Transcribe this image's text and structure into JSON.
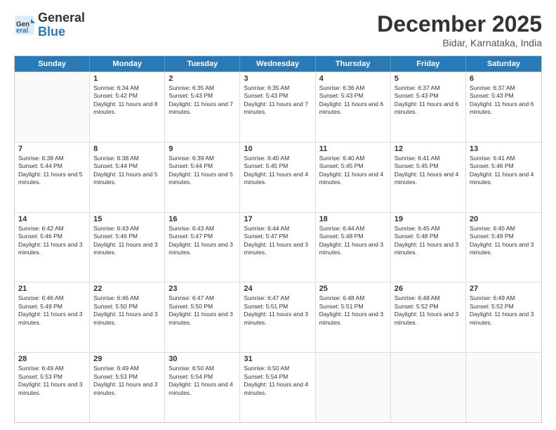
{
  "header": {
    "logo": {
      "general": "General",
      "blue": "Blue"
    },
    "title": "December 2025",
    "location": "Bidar, Karnataka, India"
  },
  "days_of_week": [
    "Sunday",
    "Monday",
    "Tuesday",
    "Wednesday",
    "Thursday",
    "Friday",
    "Saturday"
  ],
  "weeks": [
    [
      {
        "day": "",
        "sunrise": "",
        "sunset": "",
        "daylight": ""
      },
      {
        "day": "1",
        "sunrise": "Sunrise: 6:34 AM",
        "sunset": "Sunset: 5:42 PM",
        "daylight": "Daylight: 11 hours and 8 minutes."
      },
      {
        "day": "2",
        "sunrise": "Sunrise: 6:35 AM",
        "sunset": "Sunset: 5:43 PM",
        "daylight": "Daylight: 11 hours and 7 minutes."
      },
      {
        "day": "3",
        "sunrise": "Sunrise: 6:35 AM",
        "sunset": "Sunset: 5:43 PM",
        "daylight": "Daylight: 11 hours and 7 minutes."
      },
      {
        "day": "4",
        "sunrise": "Sunrise: 6:36 AM",
        "sunset": "Sunset: 5:43 PM",
        "daylight": "Daylight: 11 hours and 6 minutes."
      },
      {
        "day": "5",
        "sunrise": "Sunrise: 6:37 AM",
        "sunset": "Sunset: 5:43 PM",
        "daylight": "Daylight: 11 hours and 6 minutes."
      },
      {
        "day": "6",
        "sunrise": "Sunrise: 6:37 AM",
        "sunset": "Sunset: 5:43 PM",
        "daylight": "Daylight: 11 hours and 6 minutes."
      }
    ],
    [
      {
        "day": "7",
        "sunrise": "Sunrise: 6:38 AM",
        "sunset": "Sunset: 5:44 PM",
        "daylight": "Daylight: 11 hours and 5 minutes."
      },
      {
        "day": "8",
        "sunrise": "Sunrise: 6:38 AM",
        "sunset": "Sunset: 5:44 PM",
        "daylight": "Daylight: 11 hours and 5 minutes."
      },
      {
        "day": "9",
        "sunrise": "Sunrise: 6:39 AM",
        "sunset": "Sunset: 5:44 PM",
        "daylight": "Daylight: 11 hours and 5 minutes."
      },
      {
        "day": "10",
        "sunrise": "Sunrise: 6:40 AM",
        "sunset": "Sunset: 5:45 PM",
        "daylight": "Daylight: 11 hours and 4 minutes."
      },
      {
        "day": "11",
        "sunrise": "Sunrise: 6:40 AM",
        "sunset": "Sunset: 5:45 PM",
        "daylight": "Daylight: 11 hours and 4 minutes."
      },
      {
        "day": "12",
        "sunrise": "Sunrise: 6:41 AM",
        "sunset": "Sunset: 5:45 PM",
        "daylight": "Daylight: 11 hours and 4 minutes."
      },
      {
        "day": "13",
        "sunrise": "Sunrise: 6:41 AM",
        "sunset": "Sunset: 5:46 PM",
        "daylight": "Daylight: 11 hours and 4 minutes."
      }
    ],
    [
      {
        "day": "14",
        "sunrise": "Sunrise: 6:42 AM",
        "sunset": "Sunset: 5:46 PM",
        "daylight": "Daylight: 11 hours and 3 minutes."
      },
      {
        "day": "15",
        "sunrise": "Sunrise: 6:43 AM",
        "sunset": "Sunset: 5:46 PM",
        "daylight": "Daylight: 11 hours and 3 minutes."
      },
      {
        "day": "16",
        "sunrise": "Sunrise: 6:43 AM",
        "sunset": "Sunset: 5:47 PM",
        "daylight": "Daylight: 11 hours and 3 minutes."
      },
      {
        "day": "17",
        "sunrise": "Sunrise: 6:44 AM",
        "sunset": "Sunset: 5:47 PM",
        "daylight": "Daylight: 11 hours and 3 minutes."
      },
      {
        "day": "18",
        "sunrise": "Sunrise: 6:44 AM",
        "sunset": "Sunset: 5:48 PM",
        "daylight": "Daylight: 11 hours and 3 minutes."
      },
      {
        "day": "19",
        "sunrise": "Sunrise: 6:45 AM",
        "sunset": "Sunset: 5:48 PM",
        "daylight": "Daylight: 11 hours and 3 minutes."
      },
      {
        "day": "20",
        "sunrise": "Sunrise: 6:45 AM",
        "sunset": "Sunset: 5:49 PM",
        "daylight": "Daylight: 11 hours and 3 minutes."
      }
    ],
    [
      {
        "day": "21",
        "sunrise": "Sunrise: 6:46 AM",
        "sunset": "Sunset: 5:49 PM",
        "daylight": "Daylight: 11 hours and 3 minutes."
      },
      {
        "day": "22",
        "sunrise": "Sunrise: 6:46 AM",
        "sunset": "Sunset: 5:50 PM",
        "daylight": "Daylight: 11 hours and 3 minutes."
      },
      {
        "day": "23",
        "sunrise": "Sunrise: 6:47 AM",
        "sunset": "Sunset: 5:50 PM",
        "daylight": "Daylight: 11 hours and 3 minutes."
      },
      {
        "day": "24",
        "sunrise": "Sunrise: 6:47 AM",
        "sunset": "Sunset: 5:51 PM",
        "daylight": "Daylight: 11 hours and 3 minutes."
      },
      {
        "day": "25",
        "sunrise": "Sunrise: 6:48 AM",
        "sunset": "Sunset: 5:51 PM",
        "daylight": "Daylight: 11 hours and 3 minutes."
      },
      {
        "day": "26",
        "sunrise": "Sunrise: 6:48 AM",
        "sunset": "Sunset: 5:52 PM",
        "daylight": "Daylight: 11 hours and 3 minutes."
      },
      {
        "day": "27",
        "sunrise": "Sunrise: 6:49 AM",
        "sunset": "Sunset: 5:52 PM",
        "daylight": "Daylight: 11 hours and 3 minutes."
      }
    ],
    [
      {
        "day": "28",
        "sunrise": "Sunrise: 6:49 AM",
        "sunset": "Sunset: 5:53 PM",
        "daylight": "Daylight: 11 hours and 3 minutes."
      },
      {
        "day": "29",
        "sunrise": "Sunrise: 6:49 AM",
        "sunset": "Sunset: 5:53 PM",
        "daylight": "Daylight: 11 hours and 3 minutes."
      },
      {
        "day": "30",
        "sunrise": "Sunrise: 6:50 AM",
        "sunset": "Sunset: 5:54 PM",
        "daylight": "Daylight: 11 hours and 4 minutes."
      },
      {
        "day": "31",
        "sunrise": "Sunrise: 6:50 AM",
        "sunset": "Sunset: 5:54 PM",
        "daylight": "Daylight: 11 hours and 4 minutes."
      },
      {
        "day": "",
        "sunrise": "",
        "sunset": "",
        "daylight": ""
      },
      {
        "day": "",
        "sunrise": "",
        "sunset": "",
        "daylight": ""
      },
      {
        "day": "",
        "sunrise": "",
        "sunset": "",
        "daylight": ""
      }
    ]
  ]
}
